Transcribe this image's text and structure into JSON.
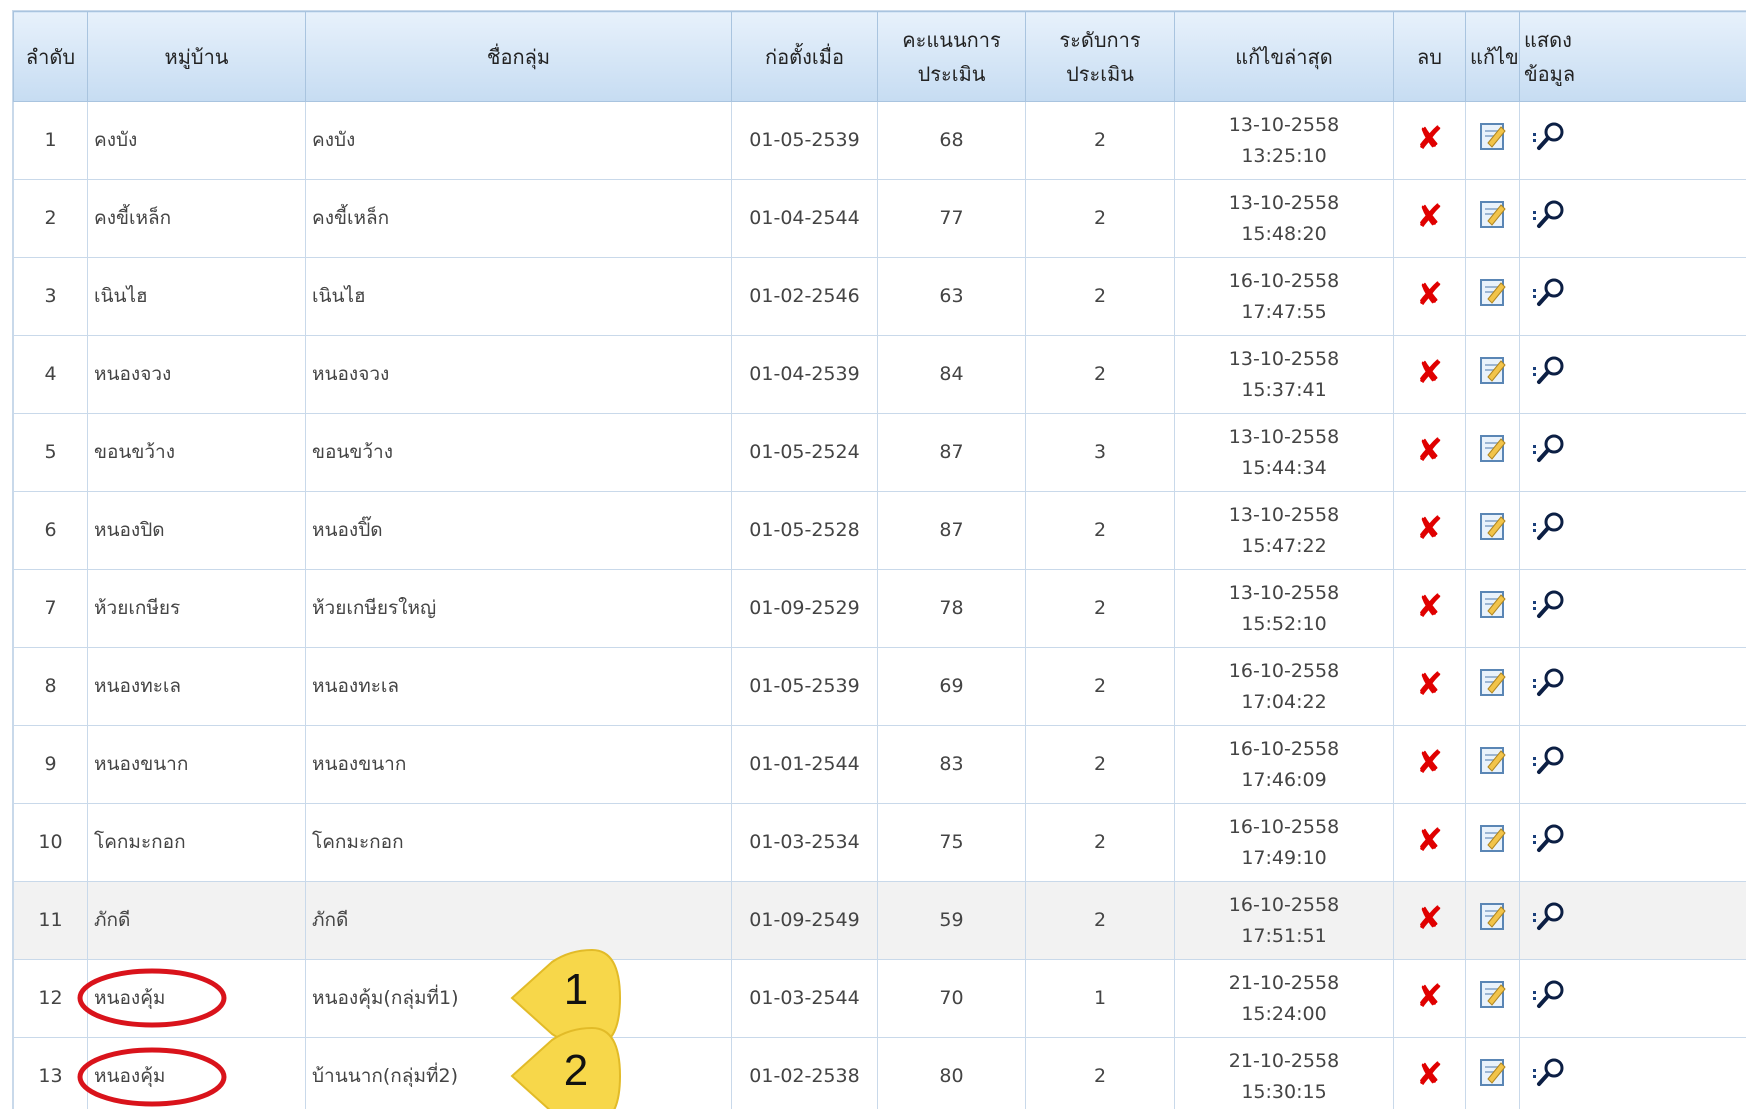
{
  "headers": {
    "order": "ลำดับ",
    "village": "หมู่บ้าน",
    "group": "ชื่อกลุ่ม",
    "founded": "ก่อตั้งเมื่อ",
    "score_1": "คะแนนการ",
    "score_2": "ประเมิน",
    "level_1": "ระดับการ",
    "level_2": "ประเมิน",
    "modified": "แก้ไขล่าสุด",
    "delete": "ลบ",
    "edit": "แก้ไข",
    "show_1": "แสดง",
    "show_2": "ข้อมูล"
  },
  "icons": {
    "delete": "✘",
    "edit": "edit-note-icon",
    "view": "magnifier-icon"
  },
  "rows": [
    {
      "no": "1",
      "village": "คงบัง",
      "group": "คงบัง",
      "founded": "01-05-2539",
      "score": "68",
      "level": "2",
      "date": "13-10-2558",
      "time": "13:25:10"
    },
    {
      "no": "2",
      "village": "คงขี้เหล็ก",
      "group": "คงขี้เหล็ก",
      "founded": "01-04-2544",
      "score": "77",
      "level": "2",
      "date": "13-10-2558",
      "time": "15:48:20"
    },
    {
      "no": "3",
      "village": "เนินไฮ",
      "group": "เนินไฮ",
      "founded": "01-02-2546",
      "score": "63",
      "level": "2",
      "date": "16-10-2558",
      "time": "17:47:55"
    },
    {
      "no": "4",
      "village": "หนองจวง",
      "group": "หนองจวง",
      "founded": "01-04-2539",
      "score": "84",
      "level": "2",
      "date": "13-10-2558",
      "time": "15:37:41"
    },
    {
      "no": "5",
      "village": "ขอนขว้าง",
      "group": "ขอนขว้าง",
      "founded": "01-05-2524",
      "score": "87",
      "level": "3",
      "date": "13-10-2558",
      "time": "15:44:34"
    },
    {
      "no": "6",
      "village": "หนองปิด",
      "group": "หนองปิ๊ด",
      "founded": "01-05-2528",
      "score": "87",
      "level": "2",
      "date": "13-10-2558",
      "time": "15:47:22"
    },
    {
      "no": "7",
      "village": "ห้วยเกษียร",
      "group": "ห้วยเกษียรใหญ่",
      "founded": "01-09-2529",
      "score": "78",
      "level": "2",
      "date": "13-10-2558",
      "time": "15:52:10"
    },
    {
      "no": "8",
      "village": "หนองทะเล",
      "group": "หนองทะเล",
      "founded": "01-05-2539",
      "score": "69",
      "level": "2",
      "date": "16-10-2558",
      "time": "17:04:22"
    },
    {
      "no": "9",
      "village": "หนองขนาก",
      "group": "หนองขนาก",
      "founded": "01-01-2544",
      "score": "83",
      "level": "2",
      "date": "16-10-2558",
      "time": "17:46:09"
    },
    {
      "no": "10",
      "village": "โคกมะกอก",
      "group": "โคกมะกอก",
      "founded": "01-03-2534",
      "score": "75",
      "level": "2",
      "date": "16-10-2558",
      "time": "17:49:10"
    },
    {
      "no": "11",
      "village": "ภักดี",
      "group": "ภักดี",
      "founded": "01-09-2549",
      "score": "59",
      "level": "2",
      "date": "16-10-2558",
      "time": "17:51:51"
    },
    {
      "no": "12",
      "village": "หนองคุ้ม",
      "group": "หนองคุ้ม(กลุ่มที่1)",
      "founded": "01-03-2544",
      "score": "70",
      "level": "1",
      "date": "21-10-2558",
      "time": "15:24:00"
    },
    {
      "no": "13",
      "village": "หนองคุ้ม",
      "group": "บ้านนาก(กลุ่มที่2)",
      "founded": "01-02-2538",
      "score": "80",
      "level": "2",
      "date": "21-10-2558",
      "time": "15:30:15"
    }
  ],
  "highlight_row": "11",
  "annotations": {
    "callout_1": "1",
    "callout_2": "2"
  },
  "colors": {
    "delete": "#e00000",
    "callout": "#f7d74a",
    "circle": "#d9131b"
  }
}
